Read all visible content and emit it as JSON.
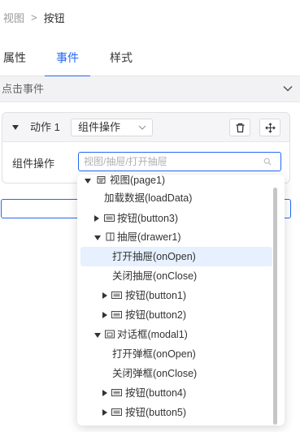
{
  "breadcrumb": {
    "parent": "视图",
    "separator": ">",
    "current": "按钮"
  },
  "tabs": [
    {
      "label": "属性"
    },
    {
      "label": "事件"
    },
    {
      "label": "样式"
    }
  ],
  "section": {
    "label": "点击事件"
  },
  "action": {
    "label": "动作 1",
    "type_value": "组件操作",
    "row_label": "组件操作",
    "input_placeholder": "视图/抽屉/打开抽屉",
    "input_value": ""
  },
  "tree": {
    "items": [
      {
        "label": "视图(page1)",
        "icon": "page-icon",
        "toggle": "expanded",
        "level": 0
      },
      {
        "label": "加载数据(loadData)",
        "icon": "",
        "toggle": "none",
        "level": 1
      },
      {
        "label": "按钮(button3)",
        "icon": "button-icon",
        "toggle": "collapsed",
        "level": 1
      },
      {
        "label": "抽屉(drawer1)",
        "icon": "drawer-icon",
        "toggle": "expanded",
        "level": 1
      },
      {
        "label": "打开抽屉(onOpen)",
        "icon": "",
        "toggle": "none",
        "level": 2,
        "selected": true
      },
      {
        "label": "关闭抽屉(onClose)",
        "icon": "",
        "toggle": "none",
        "level": 2
      },
      {
        "label": "按钮(button1)",
        "icon": "button-icon",
        "toggle": "collapsed",
        "level": 2
      },
      {
        "label": "按钮(button2)",
        "icon": "button-icon",
        "toggle": "collapsed",
        "level": 2
      },
      {
        "label": "对话框(modal1)",
        "icon": "dialog-icon",
        "toggle": "expanded",
        "level": 1
      },
      {
        "label": "打开弹框(onOpen)",
        "icon": "",
        "toggle": "none",
        "level": 2
      },
      {
        "label": "关闭弹框(onClose)",
        "icon": "",
        "toggle": "none",
        "level": 2
      },
      {
        "label": "按钮(button4)",
        "icon": "button-icon",
        "toggle": "collapsed",
        "level": 2
      },
      {
        "label": "按钮(button5)",
        "icon": "button-icon",
        "toggle": "collapsed",
        "level": 2
      }
    ]
  },
  "colors": {
    "accent": "#2468f2",
    "selected_bg": "#e6f0fe"
  }
}
